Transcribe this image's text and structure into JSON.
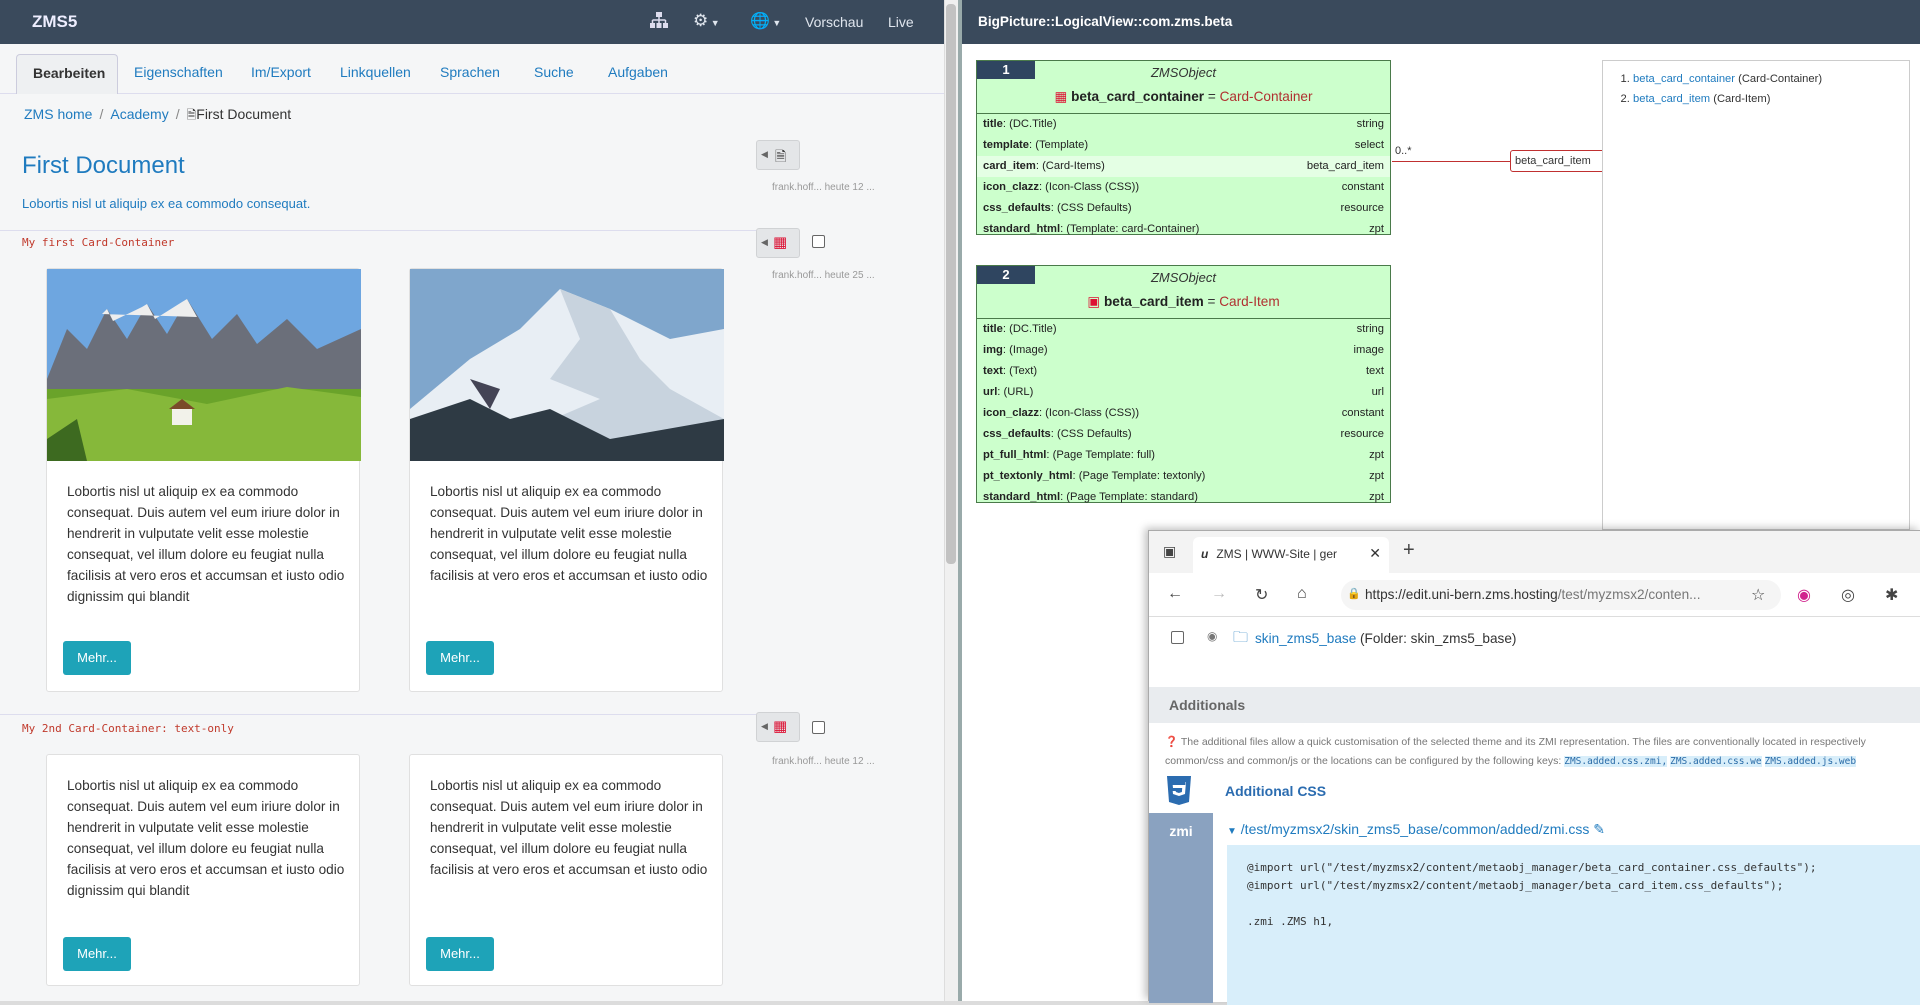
{
  "app": {
    "brand": "ZMS5",
    "preview": "Vorschau",
    "live": "Live"
  },
  "tabs": [
    "Bearbeiten",
    "Eigenschaften",
    "Im/Export",
    "Linkquellen",
    "Sprachen",
    "Suche",
    "Aufgaben"
  ],
  "breadcrumb": {
    "home": "ZMS home",
    "section": "Academy",
    "current": "First Document"
  },
  "document": {
    "title": "First Document",
    "subtitle": "Lobortis nisl ut aliquip ex ea commodo consequat."
  },
  "sections": [
    {
      "label": "My first Card-Container",
      "meta": "frank.hoff...  heute 25 ..."
    },
    {
      "label": "My 2nd Card-Container: text-only",
      "meta": "frank.hoff...  heute 12 ..."
    }
  ],
  "doc_meta": "frank.hoff...  heute 12 ...",
  "cards": [
    {
      "text": "Lobortis nisl ut aliquip ex ea commodo consequat. Duis autem vel eum iriure dolor in hendrerit in vulputate velit esse molestie consequat, vel illum dolore eu feugiat nulla facilisis at vero eros et accumsan et iusto odio dignissim qui blandit",
      "button": "Mehr..."
    },
    {
      "text": "Lobortis nisl ut aliquip ex ea commodo consequat. Duis autem vel eum iriure dolor in hendrerit in vulputate velit esse molestie consequat, vel illum dolore eu feugiat nulla facilisis at vero eros et accumsan et iusto odio",
      "button": "Mehr..."
    },
    {
      "text": "Lobortis nisl ut aliquip ex ea commodo consequat. Duis autem vel eum iriure dolor in hendrerit in vulputate velit esse molestie consequat, vel illum dolore eu feugiat nulla facilisis at vero eros et accumsan et iusto odio dignissim qui blandit",
      "button": "Mehr..."
    },
    {
      "text": "Lobortis nisl ut aliquip ex ea commodo consequat. Duis autem vel eum iriure dolor in hendrerit in vulputate velit esse molestie consequat, vel illum dolore eu feugiat nulla facilisis at vero eros et accumsan et iusto odio",
      "button": "Mehr..."
    }
  ],
  "bigpicture": {
    "title": "BigPicture::LogicalView::com.zms.beta",
    "classes": [
      {
        "num": "1",
        "stereo": "ZMSObject",
        "id": "beta_card_container",
        "name": "Card-Container",
        "attrs": [
          {
            "n": "title",
            "d": "(DC.Title)",
            "t": "string"
          },
          {
            "n": "template",
            "d": "(Template)",
            "t": "select"
          },
          {
            "n": "card_item",
            "d": "(Card-Items)",
            "t": "beta_card_item"
          },
          {
            "n": "icon_clazz",
            "d": "(Icon-Class (CSS))",
            "t": "constant"
          },
          {
            "n": "css_defaults",
            "d": "(CSS Defaults)",
            "t": "resource"
          },
          {
            "n": "standard_html",
            "d": "(Template: card-Container)",
            "t": "zpt"
          }
        ]
      },
      {
        "num": "2",
        "stereo": "ZMSObject",
        "id": "beta_card_item",
        "name": "Card-Item",
        "attrs": [
          {
            "n": "title",
            "d": "(DC.Title)",
            "t": "string"
          },
          {
            "n": "img",
            "d": "(Image)",
            "t": "image"
          },
          {
            "n": "text",
            "d": "(Text)",
            "t": "text"
          },
          {
            "n": "url",
            "d": "(URL)",
            "t": "url"
          },
          {
            "n": "icon_clazz",
            "d": "(Icon-Class (CSS))",
            "t": "constant"
          },
          {
            "n": "css_defaults",
            "d": "(CSS Defaults)",
            "t": "resource"
          },
          {
            "n": "pt_full_html",
            "d": "(Page Template: full)",
            "t": "zpt"
          },
          {
            "n": "pt_textonly_html",
            "d": "(Page Template: textonly)",
            "t": "zpt"
          },
          {
            "n": "standard_html",
            "d": "(Page Template: standard)",
            "t": "zpt"
          }
        ]
      }
    ],
    "assoc_card": "0..*",
    "assoc_target": "beta_card_item",
    "list": [
      {
        "id": "beta_card_container",
        "name": "(Card-Container)"
      },
      {
        "id": "beta_card_item",
        "name": "(Card-Item)"
      }
    ]
  },
  "browser": {
    "tab_title": "ZMS | WWW-Site | ger",
    "url_host": "https://edit.uni-bern.zms.hosting",
    "url_path": "/test/myzmsx2/conten...",
    "folder_link": "skin_zms5_base",
    "folder_desc": "(Folder: skin_zms5_base)",
    "additionals_header": "Additionals",
    "note": "The additional files allow a quick customisation of the selected theme and its ZMI representation. The files are conventionally located in respectively common/css and common/js or the locations can be configured by the following keys:",
    "note_keys": [
      "ZMS.added.css.zmi,",
      "ZMS.added.css.we",
      "ZMS.added.js.web"
    ],
    "css_label": "Additional CSS",
    "zmi_label": "zmi",
    "zmi_path": "/test/myzmsx2/skin_zms5_base/common/added/zmi.css",
    "code": "@import url(\"/test/myzmsx2/content/metaobj_manager/beta_card_container.css_defaults\");\n@import url(\"/test/myzmsx2/content/metaobj_manager/beta_card_item.css_defaults\");\n\n.zmi .ZMS h1,"
  }
}
